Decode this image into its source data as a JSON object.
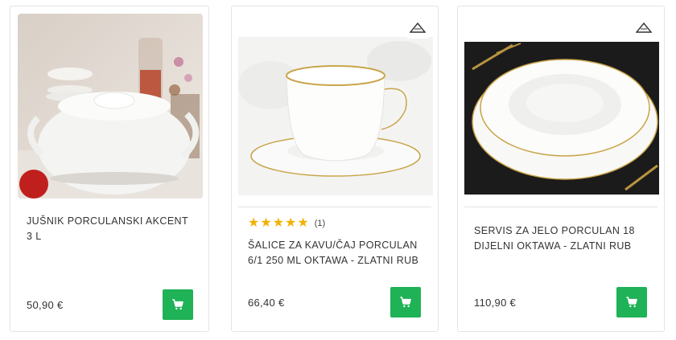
{
  "products": [
    {
      "title": "JUŠNIK PORCULANSKI AKCENT 3 L",
      "price": "50,90 €",
      "image": "white-porcelain-soup-tureen-photo",
      "cart_icon": "shopping-cart-icon"
    },
    {
      "title": "ŠALICE ZA KAVU/ČAJ PORCULAN 6/1 250 ML OKTAWA - ZLATNI RUB",
      "price": "66,40 €",
      "rating_stars": 5,
      "rating_count": "(1)",
      "image": "white-gold-rim-cup-and-saucer-photo",
      "cart_icon": "shopping-cart-icon"
    },
    {
      "title": "SERVIS ZA JELO PORCULAN 18 DIJELNI OKTAWA - ZLATNI RUB",
      "price": "110,90 €",
      "image": "white-gold-rim-plate-set-photo",
      "cart_icon": "shopping-cart-icon"
    }
  ],
  "colors": {
    "cart_button": "#1fb257",
    "star": "#f2b100",
    "border": "#e4e4e4"
  }
}
